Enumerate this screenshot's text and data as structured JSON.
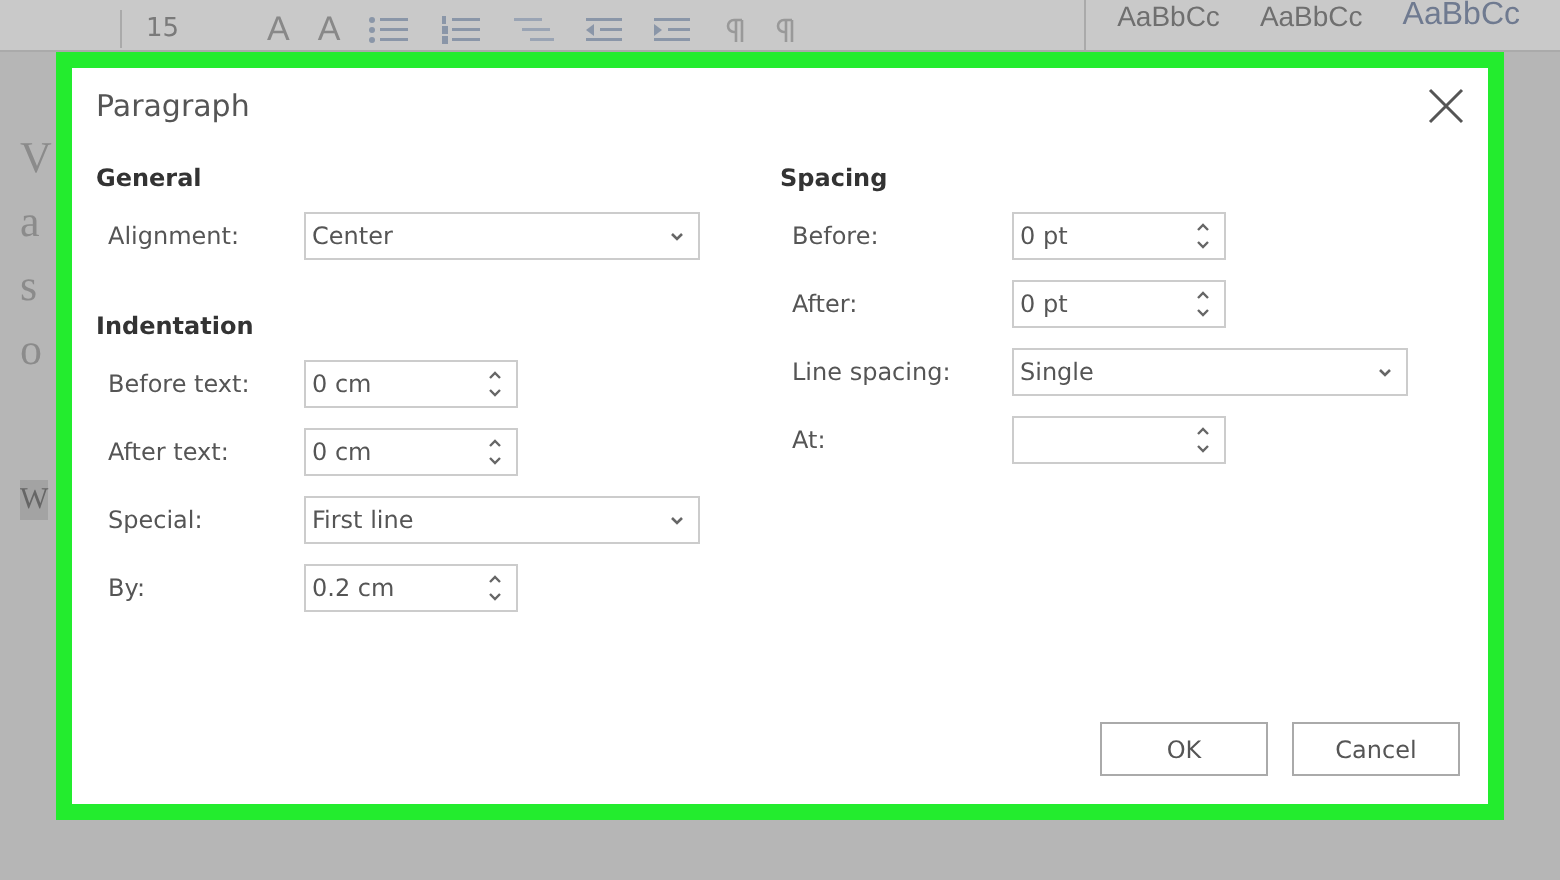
{
  "ribbon": {
    "font_size": "15",
    "font_buttons": [
      "A",
      "A"
    ],
    "styles": [
      "AaBbCc",
      "AaBbCc",
      "AaBbCc"
    ]
  },
  "document": {
    "lines": [
      "V",
      "a",
      "s",
      "o"
    ],
    "selected_text": "W"
  },
  "dialog": {
    "title": "Paragraph",
    "left": [
      {
        "heading": "General",
        "fields": [
          {
            "label": "Alignment:",
            "kind": "select",
            "value": "Center"
          }
        ]
      },
      {
        "heading": "Indentation",
        "fields": [
          {
            "label": "Before text:",
            "kind": "spin",
            "value": "0 cm"
          },
          {
            "label": "After text:",
            "kind": "spin",
            "value": "0 cm"
          },
          {
            "label": "Special:",
            "kind": "select",
            "value": "First line"
          },
          {
            "label": "By:",
            "kind": "spin",
            "value": "0.2 cm"
          }
        ]
      }
    ],
    "right": [
      {
        "heading": "Spacing",
        "fields": [
          {
            "label": "Before:",
            "kind": "spin",
            "value": "0 pt"
          },
          {
            "label": "After:",
            "kind": "spin",
            "value": "0 pt"
          },
          {
            "label": "Line spacing:",
            "kind": "select",
            "value": "Single"
          },
          {
            "label": "At:",
            "kind": "spin"
          }
        ]
      }
    ],
    "buttons": [
      "OK",
      "Cancel"
    ]
  }
}
